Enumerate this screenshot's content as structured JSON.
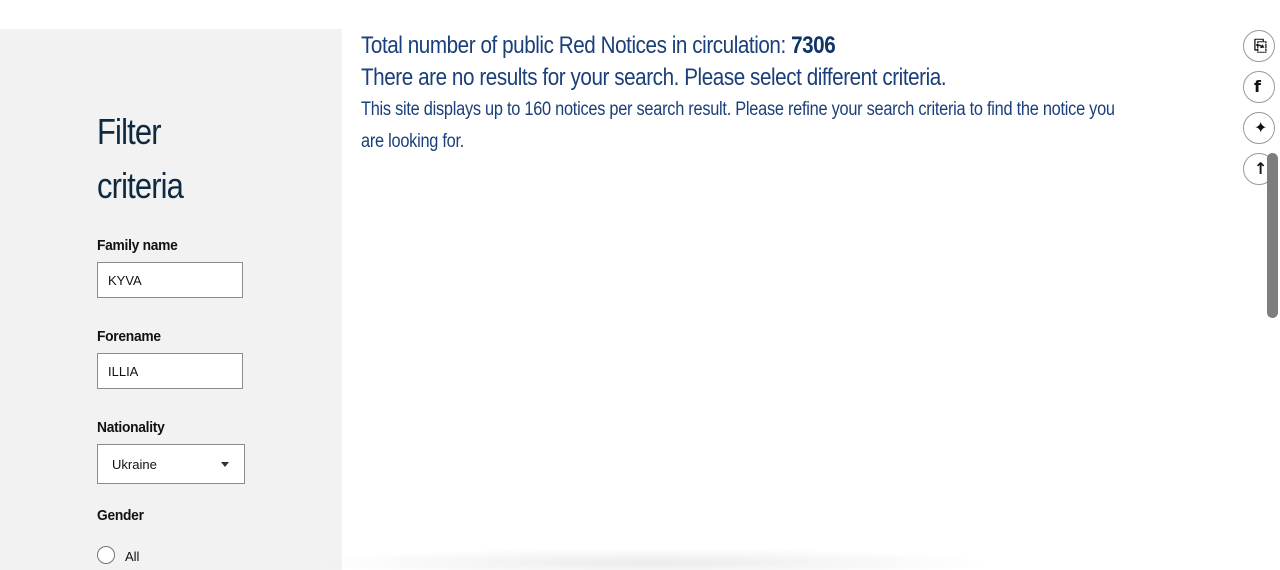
{
  "filter": {
    "title_line1": "Filter",
    "title_line2": "criteria",
    "family_name": {
      "label": "Family name",
      "value": "KYVA"
    },
    "forename": {
      "label": "Forename",
      "value": "ILLIA"
    },
    "nationality": {
      "label": "Nationality",
      "value": "Ukraine"
    },
    "gender": {
      "label": "Gender",
      "options": [
        "All"
      ],
      "selected": null
    }
  },
  "results": {
    "total_prefix": "Total number of public Red Notices in circulation: ",
    "total_count": "7306",
    "no_results": "There are no results for your search. Please select different criteria.",
    "note": "This site displays up to 160 notices per search result. Please refine your search criteria to find the notice you are looking for."
  },
  "share": {
    "icons": [
      "print-icon",
      "facebook-icon",
      "twitter-icon",
      "back-to-top-icon"
    ]
  },
  "colors": {
    "panel_bg": "#f2f2f2",
    "results_text": "#1b3f7a",
    "title_text": "#0e2a43"
  }
}
